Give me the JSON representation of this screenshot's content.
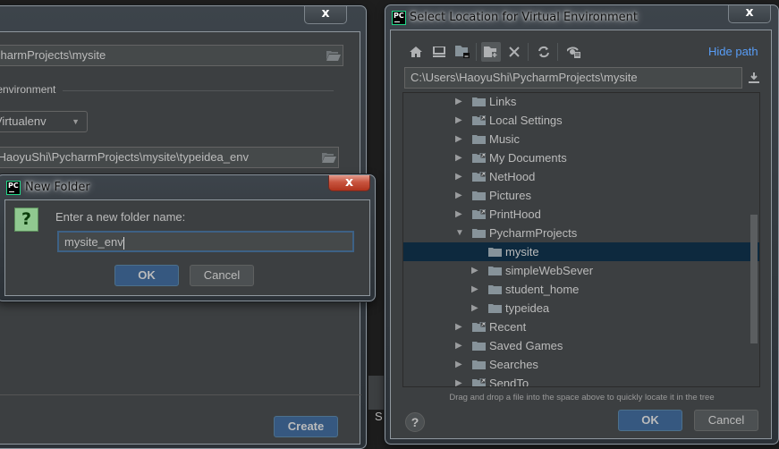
{
  "create_dialog": {
    "close_label": "x",
    "location_value": "charmProjects\\mysite",
    "section_label": "v environment",
    "env_type_value": "Virtualenv",
    "env_path_value": "\\HaoyuShi\\PycharmProjects\\mysite\\typeidea_env",
    "create_label": "Create",
    "partial_label": "S"
  },
  "new_folder_dialog": {
    "title": "New Folder",
    "logo_text": "PC",
    "close_label": "x",
    "question_icon": "?",
    "prompt": "Enter a new folder name:",
    "input_value": "mysite_env",
    "ok_label": "OK",
    "cancel_label": "Cancel"
  },
  "select_dialog": {
    "title": "Select Location for Virtual Environment",
    "logo_text": "PC",
    "close_label": "x",
    "toolbar": {
      "icons": [
        "home-icon",
        "desktop-icon",
        "project-folder-icon",
        "new-folder-icon",
        "delete-icon",
        "refresh-icon",
        "show-hidden-icon"
      ],
      "hide_path_label": "Hide path"
    },
    "path_value": "C:\\Users\\HaoyuShi\\PycharmProjects\\mysite",
    "tree": [
      {
        "label": "Links",
        "depth": 0,
        "expanded": false,
        "link": false,
        "selected": false
      },
      {
        "label": "Local Settings",
        "depth": 0,
        "expanded": false,
        "link": true,
        "selected": false
      },
      {
        "label": "Music",
        "depth": 0,
        "expanded": false,
        "link": false,
        "selected": false
      },
      {
        "label": "My Documents",
        "depth": 0,
        "expanded": false,
        "link": true,
        "selected": false
      },
      {
        "label": "NetHood",
        "depth": 0,
        "expanded": false,
        "link": true,
        "selected": false
      },
      {
        "label": "Pictures",
        "depth": 0,
        "expanded": false,
        "link": false,
        "selected": false
      },
      {
        "label": "PrintHood",
        "depth": 0,
        "expanded": false,
        "link": true,
        "selected": false
      },
      {
        "label": "PycharmProjects",
        "depth": 0,
        "expanded": true,
        "link": false,
        "selected": false
      },
      {
        "label": "mysite",
        "depth": 1,
        "expanded": null,
        "link": false,
        "selected": true
      },
      {
        "label": "simpleWebSever",
        "depth": 1,
        "expanded": false,
        "link": false,
        "selected": false
      },
      {
        "label": "student_home",
        "depth": 1,
        "expanded": false,
        "link": false,
        "selected": false
      },
      {
        "label": "typeidea",
        "depth": 1,
        "expanded": false,
        "link": false,
        "selected": false
      },
      {
        "label": "Recent",
        "depth": 0,
        "expanded": false,
        "link": true,
        "selected": false
      },
      {
        "label": "Saved Games",
        "depth": 0,
        "expanded": false,
        "link": false,
        "selected": false
      },
      {
        "label": "Searches",
        "depth": 0,
        "expanded": false,
        "link": false,
        "selected": false
      },
      {
        "label": "SendTo",
        "depth": 0,
        "expanded": false,
        "link": true,
        "selected": false
      }
    ],
    "hint": "Drag and drop a file into the space above to quickly locate it in the tree",
    "help_label": "?",
    "ok_label": "OK",
    "cancel_label": "Cancel"
  },
  "colors": {
    "accent_link": "#589df6",
    "primary_button": "#365880",
    "selection": "#0d293e",
    "panel_bg": "#3c3f41"
  }
}
